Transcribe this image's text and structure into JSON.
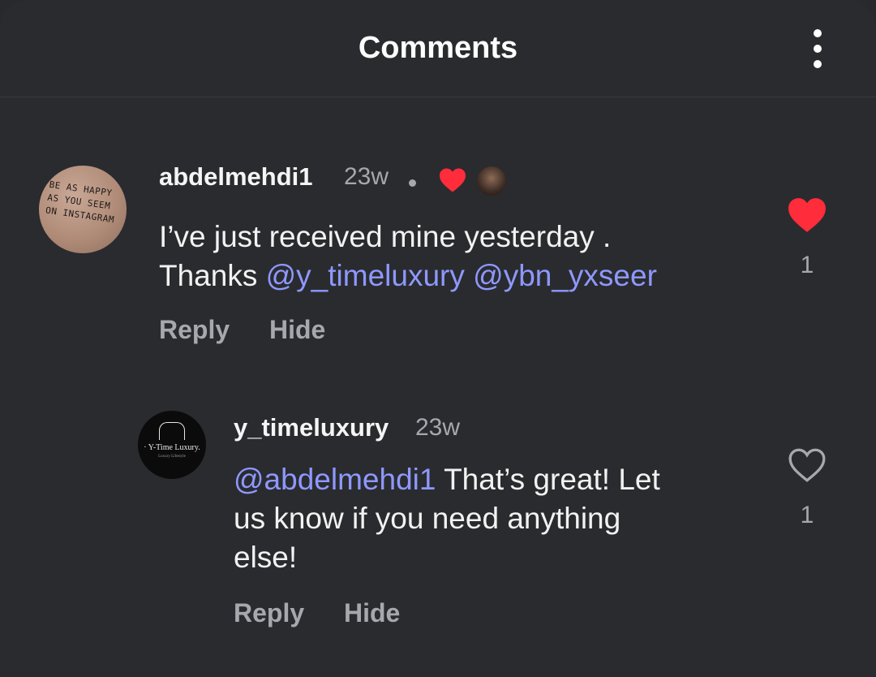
{
  "header": {
    "title": "Comments",
    "more_icon": "more-vertical-icon"
  },
  "comments": [
    {
      "username": "abdelmehdi1",
      "time": "23w",
      "avatar_text": [
        "BE AS HAPPY",
        "AS YOU SEEM",
        "ON INSTAGRAM"
      ],
      "text_line1": "I’ve just received mine yesterday .",
      "text_line2_prefix": "Thanks ",
      "mention_1": "@y_timeluxury",
      "mention_2": "@ybn_yxseer",
      "reply_label": "Reply",
      "hide_label": "Hide",
      "liked": true,
      "like_count": "1",
      "liked_by_creator": true
    },
    {
      "username": "y_timeluxury",
      "time": "23w",
      "avatar_text": "· Y-Time Luxury.",
      "avatar_subtext": "Luxury Lifestyle",
      "mention": "@abdelmehdi1",
      "text_line1_suffix": " That’s great! Let",
      "text_line2": "us know if you need anything",
      "text_line3": "else!",
      "reply_label": "Reply",
      "hide_label": "Hide",
      "liked": false,
      "like_count": "1"
    }
  ],
  "colors": {
    "background": "#2a2b2e",
    "mention": "#8e98ff",
    "like_active": "#ff2d3b",
    "secondary_text": "#a6a8ad"
  }
}
